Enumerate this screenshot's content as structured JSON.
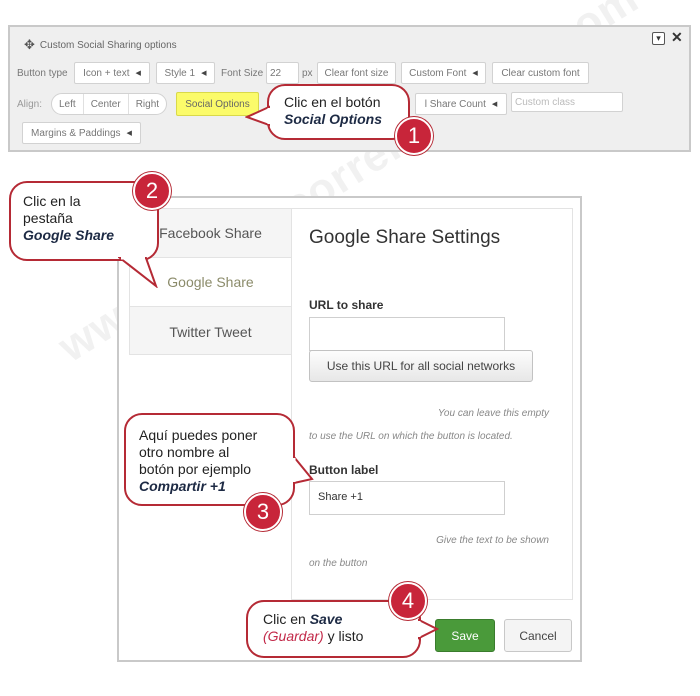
{
  "toolbar": {
    "title": "Custom Social Sharing options",
    "button_type_label": "Button type",
    "button_type_value": "Icon + text",
    "style_value": "Style 1",
    "font_size_label": "Font Size",
    "font_size_value": "22",
    "font_size_unit": "px",
    "clear_font_size": "Clear font size",
    "custom_font": "Custom Font",
    "clear_custom_font": "Clear custom font",
    "align_label": "Align:",
    "align_options": [
      "Left",
      "Center",
      "Right"
    ],
    "social_options": "Social Options",
    "share_count": "l Share Count",
    "custom_class_placeholder": "Custom class",
    "margins_paddings": "Margins & Paddings"
  },
  "tabs": [
    "Facebook Share",
    "Google Share",
    "Twitter Tweet"
  ],
  "settings": {
    "heading": "Google Share Settings",
    "url_label": "URL to share",
    "url_value": "",
    "use_url_button": "Use this URL for all social networks",
    "url_hint_1": "You can leave this empty",
    "url_hint_2": "to use the URL on which the button is located.",
    "button_label_label": "Button label",
    "button_label_value": "Share +1",
    "button_hint_1": "Give the text to be shown",
    "button_hint_2": "on the button",
    "save": "Save",
    "cancel": "Cancel"
  },
  "callouts": {
    "c1_line1": "Clic en el botón",
    "c1_bold": "Social Options",
    "c2_line1": "Clic en la",
    "c2_line2": "pestaña",
    "c2_bold": "Google Share",
    "c3_line1": "Aquí puedes poner",
    "c3_line2": "otro nombre al",
    "c3_line3": "botón por ejemplo",
    "c3_bold": "Compartir +1",
    "c4_pre": "Clic en ",
    "c4_bold": "Save",
    "c4_pink": "(Guardar)",
    "c4_post": " y listo"
  },
  "badges": [
    "1",
    "2",
    "3",
    "4"
  ],
  "watermark": "www.miguelcorrerasdurra.com",
  "colors": {
    "callout_border": "#b52a35",
    "badge": "#c8253a",
    "highlight": "#fbfb6a",
    "save": "#4a9a3a"
  }
}
